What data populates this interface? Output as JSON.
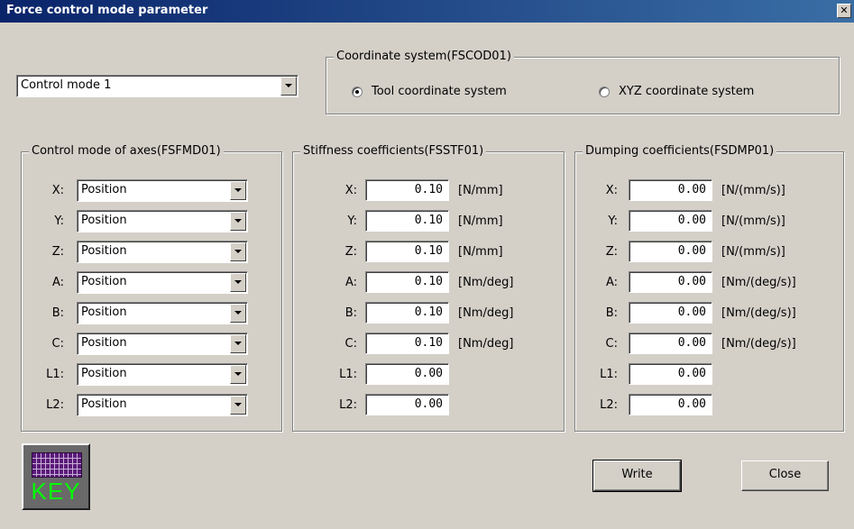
{
  "window": {
    "title": "Force control mode parameter",
    "close_glyph": "✕"
  },
  "mode_select": {
    "value": "Control mode 1"
  },
  "coordinate_system": {
    "legend": "Coordinate system(FSCOD01)",
    "options": [
      {
        "label": "Tool coordinate system",
        "checked": true
      },
      {
        "label": "XYZ coordinate system",
        "checked": false
      }
    ]
  },
  "axes": [
    {
      "label": "X:",
      "mode": "Position",
      "stiffness": "0.10",
      "stiffness_unit": "[N/mm]",
      "dumping": "0.00",
      "dumping_unit": "[N/(mm/s)]"
    },
    {
      "label": "Y:",
      "mode": "Position",
      "stiffness": "0.10",
      "stiffness_unit": "[N/mm]",
      "dumping": "0.00",
      "dumping_unit": "[N/(mm/s)]"
    },
    {
      "label": "Z:",
      "mode": "Position",
      "stiffness": "0.10",
      "stiffness_unit": "[N/mm]",
      "dumping": "0.00",
      "dumping_unit": "[N/(mm/s)]"
    },
    {
      "label": "A:",
      "mode": "Position",
      "stiffness": "0.10",
      "stiffness_unit": "[Nm/deg]",
      "dumping": "0.00",
      "dumping_unit": "[Nm/(deg/s)]"
    },
    {
      "label": "B:",
      "mode": "Position",
      "stiffness": "0.10",
      "stiffness_unit": "[Nm/deg]",
      "dumping": "0.00",
      "dumping_unit": "[Nm/(deg/s)]"
    },
    {
      "label": "C:",
      "mode": "Position",
      "stiffness": "0.10",
      "stiffness_unit": "[Nm/deg]",
      "dumping": "0.00",
      "dumping_unit": "[Nm/(deg/s)]"
    },
    {
      "label": "L1:",
      "mode": "Position",
      "stiffness": "0.00",
      "stiffness_unit": "",
      "dumping": "0.00",
      "dumping_unit": ""
    },
    {
      "label": "L2:",
      "mode": "Position",
      "stiffness": "0.00",
      "stiffness_unit": "",
      "dumping": "0.00",
      "dumping_unit": ""
    }
  ],
  "groups": {
    "control_mode": "Control mode of axes(FSFMD01)",
    "stiffness": "Stiffness coefficients(FSSTF01)",
    "dumping": "Dumping coefficients(FSDMP01)"
  },
  "key_icon": {
    "text": "KEY",
    "icon": "keyboard-icon"
  },
  "buttons": {
    "write": "Write",
    "close": "Close"
  }
}
